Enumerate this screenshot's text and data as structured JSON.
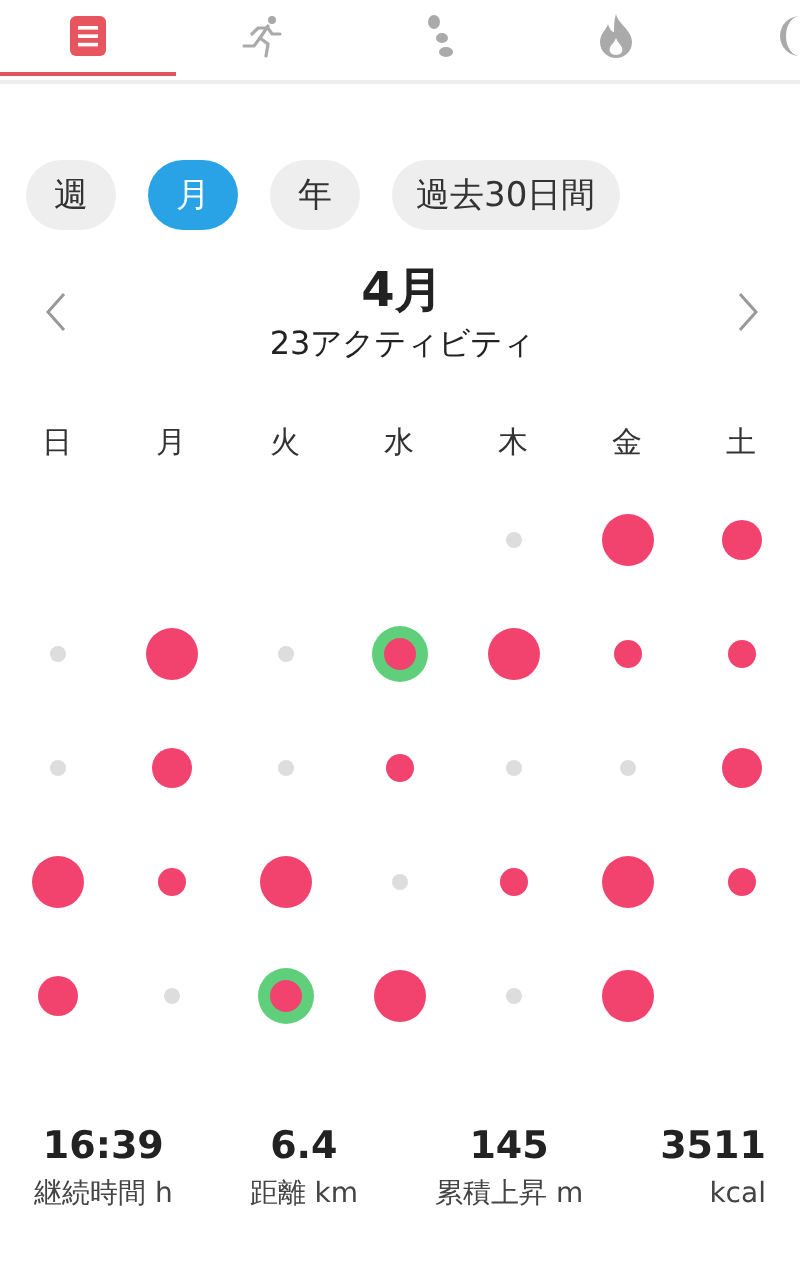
{
  "tabs": [
    {
      "selected": true
    },
    {
      "selected": false
    },
    {
      "selected": false
    },
    {
      "selected": false
    },
    {
      "selected": false
    }
  ],
  "period_filters": [
    {
      "label": "週",
      "selected": false
    },
    {
      "label": "月",
      "selected": true
    },
    {
      "label": "年",
      "selected": false
    },
    {
      "label": "過去30日間",
      "selected": false
    }
  ],
  "month": {
    "title": "4月",
    "subtitle": "23アクティビティ"
  },
  "weekdays": [
    "日",
    "月",
    "火",
    "水",
    "木",
    "金",
    "土"
  ],
  "calendar_weeks": [
    [
      {
        "kind": "empty"
      },
      {
        "kind": "empty"
      },
      {
        "kind": "empty"
      },
      {
        "kind": "empty"
      },
      {
        "kind": "rest"
      },
      {
        "kind": "intense",
        "highlighted": false
      },
      {
        "kind": "moderate",
        "highlighted": false
      }
    ],
    [
      {
        "kind": "rest"
      },
      {
        "kind": "intense",
        "highlighted": false
      },
      {
        "kind": "rest"
      },
      {
        "kind": "moderate",
        "highlighted": true
      },
      {
        "kind": "intense",
        "highlighted": false
      },
      {
        "kind": "light",
        "highlighted": false
      },
      {
        "kind": "light",
        "highlighted": false
      }
    ],
    [
      {
        "kind": "rest"
      },
      {
        "kind": "moderate",
        "highlighted": false
      },
      {
        "kind": "rest"
      },
      {
        "kind": "light",
        "highlighted": false
      },
      {
        "kind": "rest"
      },
      {
        "kind": "rest"
      },
      {
        "kind": "moderate",
        "highlighted": false
      }
    ],
    [
      {
        "kind": "intense",
        "highlighted": false
      },
      {
        "kind": "light",
        "highlighted": false
      },
      {
        "kind": "intense",
        "highlighted": false
      },
      {
        "kind": "rest"
      },
      {
        "kind": "light",
        "highlighted": false
      },
      {
        "kind": "intense",
        "highlighted": false
      },
      {
        "kind": "light",
        "highlighted": false
      }
    ],
    [
      {
        "kind": "moderate",
        "highlighted": false
      },
      {
        "kind": "rest"
      },
      {
        "kind": "moderate",
        "highlighted": true
      },
      {
        "kind": "intense",
        "highlighted": false
      },
      {
        "kind": "rest"
      },
      {
        "kind": "intense",
        "highlighted": false
      },
      {
        "kind": "empty"
      }
    ]
  ],
  "stats": [
    {
      "value": "16:39",
      "label": "継続時間 h"
    },
    {
      "value": "6.4",
      "label": "距離 km"
    },
    {
      "value": "145",
      "label": "累積上昇 m"
    },
    {
      "value": "3511",
      "label": "kcal"
    }
  ]
}
